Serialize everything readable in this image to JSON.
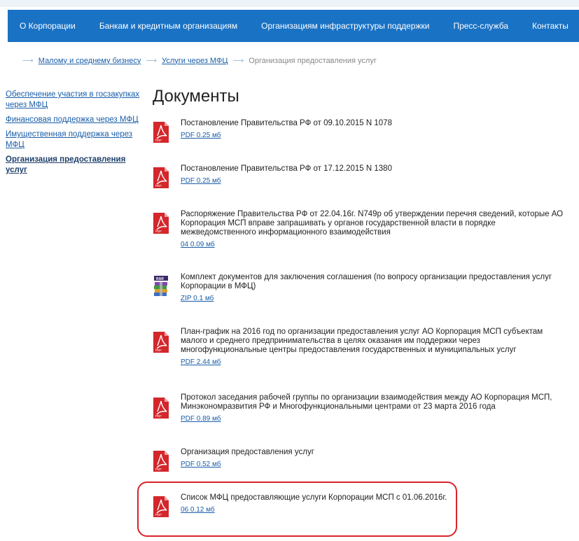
{
  "nav": {
    "items": [
      {
        "label": "О Корпорации"
      },
      {
        "label": "Банкам и кредитным организациям"
      },
      {
        "label": "Организациям инфраструктуры поддержки"
      },
      {
        "label": "Пресс-служба"
      },
      {
        "label": "Контакты"
      }
    ],
    "color": "#1a72c4"
  },
  "breadcrumb": {
    "items": [
      {
        "label": "Малому и среднему бизнесу"
      },
      {
        "label": "Услуги через МФЦ"
      }
    ],
    "current": "Организация предоставления услуг"
  },
  "sidebar": {
    "items": [
      {
        "label": "Обеспечение участия в госзакупках через МФЦ"
      },
      {
        "label": "Финансовая поддержка через МФЦ"
      },
      {
        "label": "Имущественная поддержка через МФЦ"
      },
      {
        "label": "Организация предоставления услуг"
      }
    ],
    "active_index": 3
  },
  "main": {
    "heading": "Документы",
    "documents": [
      {
        "icon": "pdf-icon",
        "title": "Постановление Правительства РФ от 09.10.2015 N 1078",
        "link": "PDF 0.25 мб"
      },
      {
        "icon": "pdf-icon",
        "title": "Постановление Правительства РФ от 17.12.2015 N 1380",
        "link": "PDF 0.25 мб"
      },
      {
        "icon": "pdf-icon",
        "title": "Распоряжение Правительства РФ от 22.04.16г. N749р об утверждении перечня сведений, которые АО Корпорация МСП вправе запрашивать у органов государственной власти в порядке межведомственного информационного взаимодействия",
        "link": "04 0.09 мб"
      },
      {
        "icon": "rar-icon",
        "title": "Комплект документов для заключения соглашения (по вопросу организации предоставления услуг Корпорации в МФЦ)",
        "link": "ZIP 0.1 мб"
      },
      {
        "icon": "pdf-icon",
        "title": "План-график на 2016 год по организации предоставления услуг АО Корпорация МСП субъектам малого и среднего предпринимательства в целях оказания им поддержки через многофункциональные центры предоставления государственных и муниципальных услуг",
        "link": "PDF 2.44 мб"
      },
      {
        "icon": "pdf-icon",
        "title": "Протокол заседания рабочей группы по организации взаимодействия между АО Корпорация МСП, Минэкономразвития РФ и Многофункциональными центрами от 23 марта 2016 года",
        "link": "PDF 0.89 мб"
      },
      {
        "icon": "pdf-icon",
        "title": "Организация предоставления услуг",
        "link": "PDF 0.52 мб"
      },
      {
        "icon": "pdf-icon",
        "title": "Список МФЦ предоставляющие услуги Корпорации МСП с 01.06.2016г.",
        "link": "06 0.12 мб"
      }
    ],
    "highlight_color": "#d8232a"
  },
  "icons": {
    "pdf_badge": "PDF",
    "rar_badge": "RAR"
  }
}
